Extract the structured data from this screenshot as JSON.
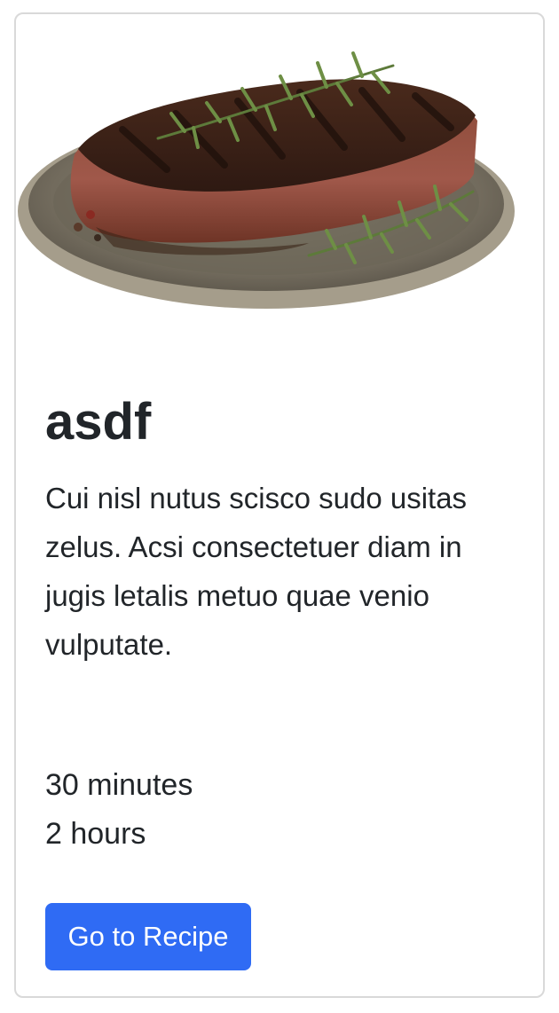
{
  "card": {
    "image_alt": "Grilled steak on a plate with rosemary",
    "title": "asdf",
    "description": "Cui nisl nutus scisco sudo usitas zelus. Acsi consectetuer diam in jugis letalis metuo quae venio vulputate.",
    "prep_time": "30 minutes",
    "total_time": "2 hours",
    "button_label": "Go to Recipe"
  },
  "colors": {
    "button": "#2f6bf4",
    "border": "#d9d9d9",
    "text": "#212529"
  }
}
